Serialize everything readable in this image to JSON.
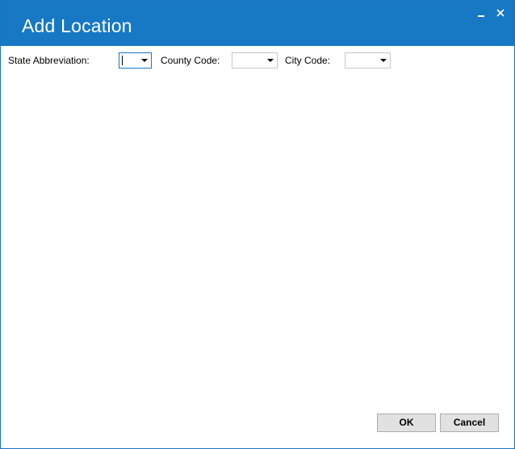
{
  "window": {
    "title": "Add Location",
    "accent_color": "#1778c4",
    "controls": {
      "minimize_icon": "minimize-icon",
      "close_icon": "close-icon"
    }
  },
  "form": {
    "state": {
      "label": "State Abbreviation:",
      "value": ""
    },
    "county": {
      "label": "County Code:",
      "value": ""
    },
    "city": {
      "label": "City Code:",
      "value": ""
    }
  },
  "footer": {
    "ok_label": "OK",
    "cancel_label": "Cancel"
  }
}
